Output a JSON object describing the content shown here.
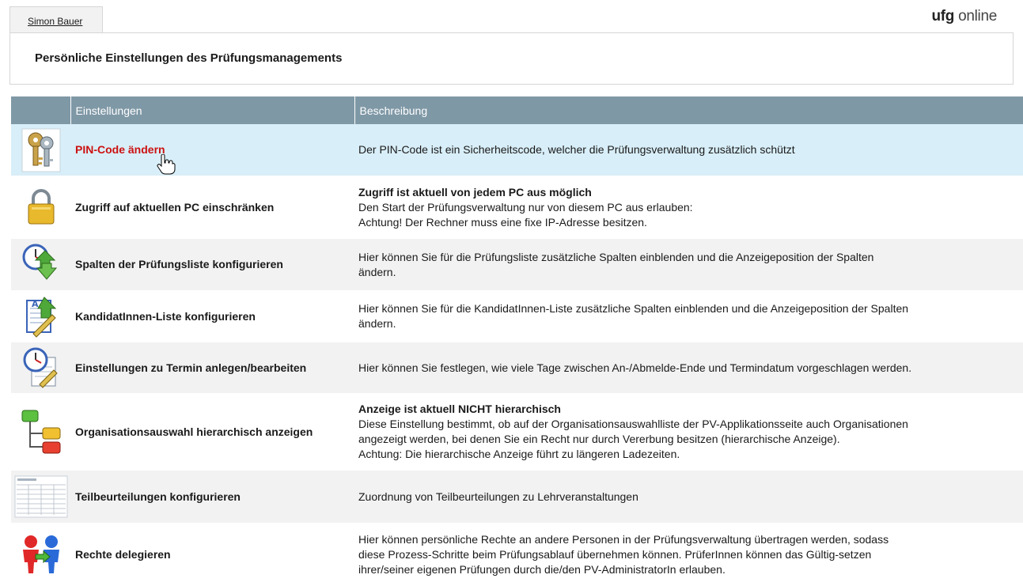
{
  "tab": {
    "user": "Simon Bauer"
  },
  "brand": {
    "bold": "ufg",
    "rest": "online"
  },
  "page": {
    "title": "Persönliche Einstellungen des Prüfungsmanagements"
  },
  "table": {
    "headers": {
      "settings": "Einstellungen",
      "description": "Beschreibung"
    },
    "rows": [
      {
        "icon": "keys-icon",
        "name": "PIN-Code ändern",
        "desc": [
          "Der PIN-Code ist ein Sicherheitscode, welcher die Prüfungsverwaltung zusätzlich schützt"
        ]
      },
      {
        "icon": "padlock-icon",
        "name": "Zugriff auf aktuellen PC einschränken",
        "bold": "Zugriff ist aktuell von jedem PC aus möglich",
        "desc": [
          "Den Start der Prüfungsverwaltung nur von diesem PC aus erlauben:",
          "Achtung! Der Rechner muss eine fixe IP-Adresse besitzen."
        ]
      },
      {
        "icon": "clock-arrows-icon",
        "name": "Spalten der Prüfungsliste konfigurieren",
        "desc": [
          "Hier können Sie für die Prüfungsliste zusätzliche Spalten einblenden und die Anzeigeposition der Spalten",
          "ändern."
        ]
      },
      {
        "icon": "document-edit-icon",
        "name": "KandidatInnen-Liste konfigurieren",
        "desc": [
          "Hier können Sie für die KandidatInnen-Liste zusätzliche Spalten einblenden und die Anzeigeposition der Spalten",
          "ändern."
        ]
      },
      {
        "icon": "calendar-clock-icon",
        "name": "Einstellungen zu Termin anlegen/bearbeiten",
        "desc": [
          "Hier können Sie festlegen, wie viele Tage zwischen An-/Abmelde-Ende und Termindatum vorgeschlagen werden."
        ]
      },
      {
        "icon": "hierarchy-icon",
        "name": "Organisationsauswahl hierarchisch anzeigen",
        "bold": "Anzeige ist aktuell NICHT hierarchisch",
        "desc": [
          "Diese Einstellung bestimmt, ob auf der Organisationsauswahlliste der PV-Applikationsseite auch Organisationen",
          "angezeigt werden, bei denen Sie ein Recht nur durch Vererbung besitzen (hierarchische Anzeige).",
          "Achtung: Die hierarchische Anzeige führt zu längeren Ladezeiten."
        ]
      },
      {
        "icon": "spreadsheet-thumbnail-icon",
        "name": "Teilbeurteilungen konfigurieren",
        "desc": [
          "Zuordnung von Teilbeurteilungen zu Lehrveranstaltungen"
        ]
      },
      {
        "icon": "delegate-users-icon",
        "name": "Rechte delegieren",
        "desc": [
          "Hier können persönliche Rechte an andere Personen in der Prüfungsverwaltung übertragen werden, sodass",
          "diese Prozess-Schritte beim Prüfungsablauf übernehmen können. PrüferInnen können das Gültig-setzen",
          "ihrer/seiner eigenen Prüfungen durch die/den PV-AdministratorIn erlauben."
        ]
      }
    ]
  },
  "colors": {
    "header_bg": "#7f98a6",
    "highlight_bg": "#d8eef8",
    "alt_bg": "#f2f2f2",
    "link_red": "#cc1111"
  }
}
